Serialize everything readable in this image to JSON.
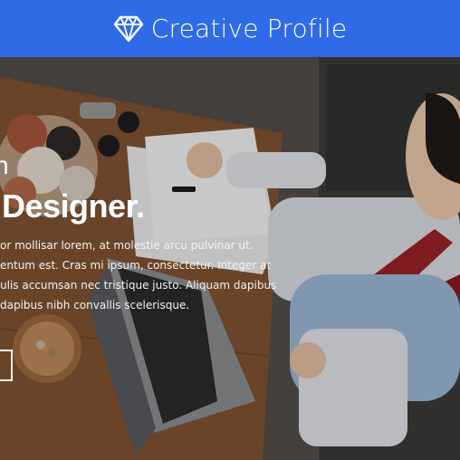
{
  "header": {
    "brand_icon": "diamond-icon",
    "brand_name": "Creative Profile",
    "background_color": "#2f6be6"
  },
  "hero": {
    "kicker": "n",
    "headline": "Designer.",
    "bio_lines": [
      "or mollisar lorem, at molestie arcu pulvinar ut.",
      "entum est. Cras mi ipsum, consectetur. Integer at",
      "ulis accumsan nec tristique justo. Aliquam dapibus",
      "dapibus nibh convallis scelerisque."
    ]
  }
}
